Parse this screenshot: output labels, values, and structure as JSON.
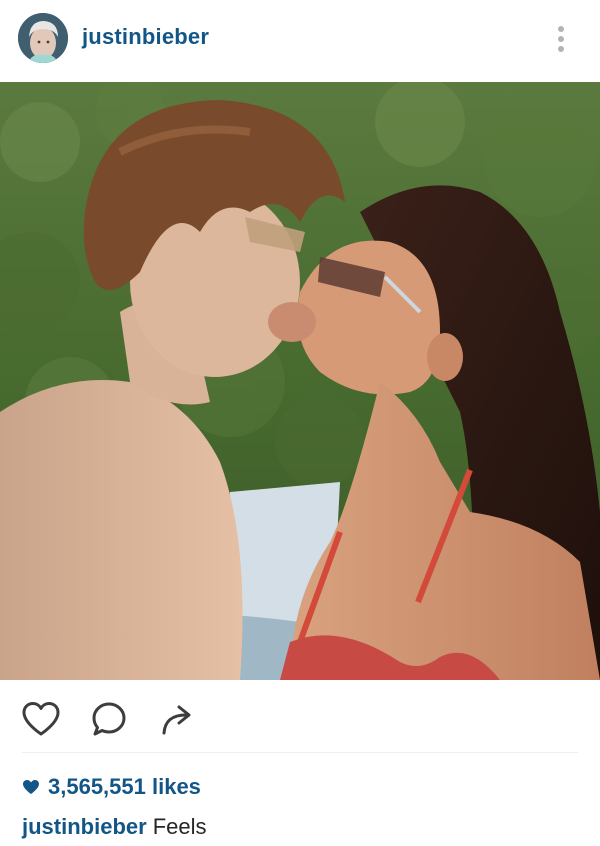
{
  "post": {
    "username": "justinbieber",
    "header_icons": {
      "avatar": "profile-avatar",
      "more": "more-vertical-icon"
    },
    "photo": {
      "description_icon": "photo"
    },
    "actions": {
      "like_icon": "heart-outline-icon",
      "comment_icon": "comment-bubble-icon",
      "share_icon": "share-arrow-icon"
    },
    "likes_text": "3,565,551 likes",
    "caption": {
      "username": "justinbieber",
      "text": "Feels"
    }
  },
  "colors": {
    "link_blue": "#125688",
    "icon_gray": "#3d3d3d",
    "text": "#262626",
    "divider": "#efefef"
  }
}
